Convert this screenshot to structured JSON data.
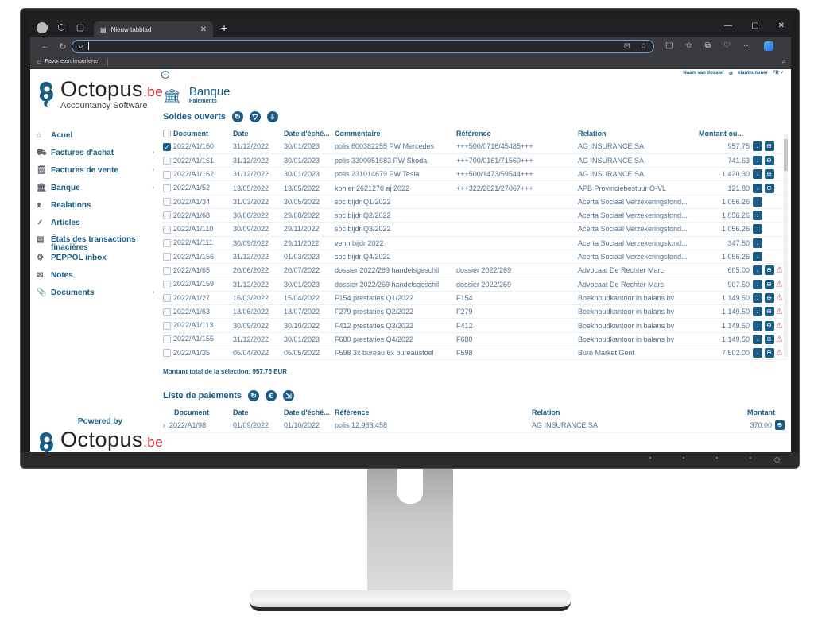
{
  "browser": {
    "tab_title": "Nieuw tabblad",
    "address_value": "",
    "favorites_label": "Favorieten importeren"
  },
  "header": {
    "dossier_name": "Naam van dossier",
    "client_number": "klantnummer",
    "language": "FR"
  },
  "logo": {
    "word": "Octopus",
    "tld": ".be",
    "tagline": "Accountancy Software",
    "powered_by": "Powered by"
  },
  "sidebar": {
    "items": [
      {
        "label": "Acuel",
        "icon": "home-icon",
        "chevron": false
      },
      {
        "label": "Factures d'achat",
        "icon": "truck-icon",
        "chevron": true
      },
      {
        "label": "Factures de vente",
        "icon": "receipt-icon",
        "chevron": true
      },
      {
        "label": "Banque",
        "icon": "bank-icon",
        "chevron": true
      },
      {
        "label": "Realations",
        "icon": "people-icon",
        "chevron": false
      },
      {
        "label": "Articles",
        "icon": "check-icon",
        "chevron": false
      },
      {
        "label": "États des transactions finacières",
        "icon": "report-icon",
        "chevron": false
      },
      {
        "label": "PEPPOL inbox",
        "icon": "gear-icon",
        "chevron": false
      },
      {
        "label": "Notes",
        "icon": "mail-icon",
        "chevron": false
      },
      {
        "label": "Documents",
        "icon": "paperclip-icon",
        "chevron": true
      }
    ]
  },
  "page": {
    "title": "Banque",
    "subtitle": "Paiements"
  },
  "soldes": {
    "title": "Soldes ouverts",
    "columns": [
      "Document",
      "Date",
      "Date d'éché...",
      "Commentaire",
      "Référence",
      "Relation",
      "Montant ou..."
    ],
    "rows": [
      {
        "checked": true,
        "doc": "2022/A1/160",
        "date": "31/12/2022",
        "due": "30/01/2023",
        "comment": "polis 600382255 PW Mercedes",
        "ref": "+++500/0716/45485+++",
        "relation": "AG INSURANCE SA",
        "amount": "957.75",
        "pay": true,
        "warn": false
      },
      {
        "checked": false,
        "doc": "2022/A1/161",
        "date": "31/12/2022",
        "due": "30/01/2023",
        "comment": "polis 3300051683 PW Skoda",
        "ref": "+++700/0161/71560+++",
        "relation": "AG INSURANCE SA",
        "amount": "741.63",
        "pay": true,
        "warn": false
      },
      {
        "checked": false,
        "doc": "2022/A1/162",
        "date": "31/12/2022",
        "due": "30/01/2023",
        "comment": "polis 231014679 PW Tesla",
        "ref": "+++500/1473/59544+++",
        "relation": "AG INSURANCE SA",
        "amount": "1 420.30",
        "pay": true,
        "warn": false
      },
      {
        "checked": false,
        "doc": "2022/A1/52",
        "date": "13/05/2022",
        "due": "13/05/2022",
        "comment": "kohier 2621270 aj 2022",
        "ref": "+++322/2621/27067+++",
        "relation": "APB Provinciebestuur O-VL",
        "amount": "121.80",
        "pay": true,
        "warn": false
      },
      {
        "checked": false,
        "doc": "2022/A1/34",
        "date": "31/03/2022",
        "due": "30/05/2022",
        "comment": "soc bijdr Q1/2022",
        "ref": "",
        "relation": "Acerta Sociaal Verzekeringsfond...",
        "amount": "1 056.26",
        "pay": false,
        "warn": false
      },
      {
        "checked": false,
        "doc": "2022/A1/68",
        "date": "30/06/2022",
        "due": "29/08/2022",
        "comment": "soc bijdr Q2/2022",
        "ref": "",
        "relation": "Acerta Sociaal Verzekeringsfond...",
        "amount": "1 056.26",
        "pay": false,
        "warn": false
      },
      {
        "checked": false,
        "doc": "2022/A1/110",
        "date": "30/09/2022",
        "due": "29/11/2022",
        "comment": "soc bijdr Q3/2022",
        "ref": "",
        "relation": "Acerta Sociaal Verzekeringsfond...",
        "amount": "1 056.26",
        "pay": false,
        "warn": false
      },
      {
        "checked": false,
        "doc": "2022/A1/111",
        "date": "30/09/2022",
        "due": "29/11/2022",
        "comment": "venn bijdr 2022",
        "ref": "",
        "relation": "Acerta Sociaal Verzekeringsfond...",
        "amount": "347.50",
        "pay": false,
        "warn": false
      },
      {
        "checked": false,
        "doc": "2022/A1/156",
        "date": "31/12/2022",
        "due": "01/03/2023",
        "comment": "soc bijdr Q4/2022",
        "ref": "",
        "relation": "Acerta Sociaal Verzekeringsfond...",
        "amount": "1 056.26",
        "pay": false,
        "warn": false
      },
      {
        "checked": false,
        "doc": "2022/A1/65",
        "date": "20/06/2022",
        "due": "20/07/2022",
        "comment": "dossier 2022/269 handelsgeschil",
        "ref": "dossier 2022/269",
        "relation": "Advocaat De Rechter Marc",
        "amount": "605.00",
        "pay": true,
        "warn": true
      },
      {
        "checked": false,
        "doc": "2022/A1/159",
        "date": "31/12/2022",
        "due": "30/01/2023",
        "comment": "dossier 2022/269 handelsgeschil",
        "ref": "dossier 2022/269",
        "relation": "Advocaat De Rechter Marc",
        "amount": "907.50",
        "pay": true,
        "warn": true
      },
      {
        "checked": false,
        "doc": "2022/A1/27",
        "date": "16/03/2022",
        "due": "15/04/2022",
        "comment": "F154 prestaties Q1/2022",
        "ref": "F154",
        "relation": "Boekhoudkantoor in balans bv",
        "amount": "1 149.50",
        "pay": true,
        "warn": true
      },
      {
        "checked": false,
        "doc": "2022/A1/63",
        "date": "18/06/2022",
        "due": "18/07/2022",
        "comment": "F279 prestaties Q2/2022",
        "ref": "F279",
        "relation": "Boekhoudkantoor in balans bv",
        "amount": "1 149.50",
        "pay": true,
        "warn": true
      },
      {
        "checked": false,
        "doc": "2022/A1/113",
        "date": "30/09/2022",
        "due": "30/10/2022",
        "comment": "F412 prestaties Q3/2022",
        "ref": "F412",
        "relation": "Boekhoudkantoor in balans bv",
        "amount": "1 149.50",
        "pay": true,
        "warn": true
      },
      {
        "checked": false,
        "doc": "2022/A1/155",
        "date": "31/12/2022",
        "due": "30/01/2023",
        "comment": "F680 prestaties Q4/2022",
        "ref": "F680",
        "relation": "Boekhoudkantoor in balans bv",
        "amount": "1 149.50",
        "pay": true,
        "warn": true
      },
      {
        "checked": false,
        "doc": "2022/A1/35",
        "date": "05/04/2022",
        "due": "05/05/2022",
        "comment": "F598 3x bureau 6x bureaustoel",
        "ref": "F598",
        "relation": "Buro Market Gent",
        "amount": "7 502.00",
        "pay": true,
        "warn": true
      }
    ],
    "total_label": "Montant total de la sélection",
    "total_value": "957.75 EUR"
  },
  "paiements": {
    "title": "Liste de paiements",
    "columns": [
      "Document",
      "Date",
      "Date d'éché...",
      "Référence",
      "Relation",
      "Montant"
    ],
    "rows": [
      {
        "doc": "2022/A1/98",
        "date": "01/09/2022",
        "due": "01/10/2022",
        "ref": "polis 12.963.458",
        "relation": "AG INSURANCE SA",
        "amount": "370.00"
      }
    ]
  },
  "colors": {
    "primary": "#1a5c86",
    "warning": "#e14a4a",
    "brand_red": "#d2232a"
  }
}
